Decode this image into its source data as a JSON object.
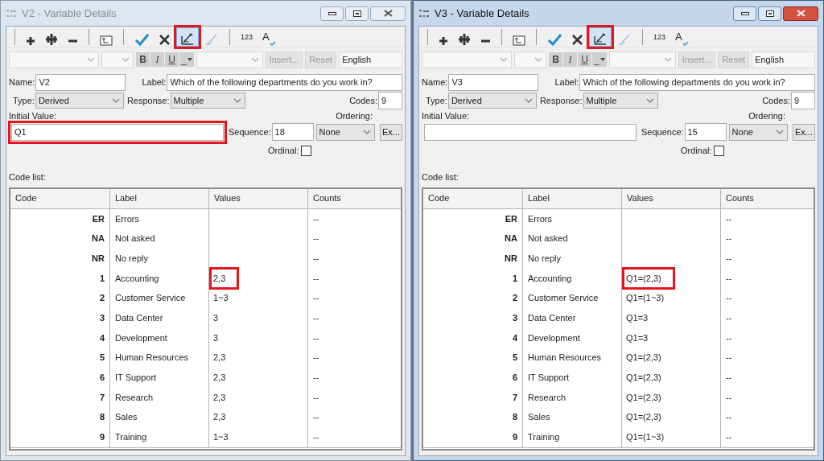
{
  "windows": [
    {
      "title": "V2 - Variable Details",
      "active": false,
      "toolbar": [
        [
          {
            "kind": "add",
            "highlighted": false,
            "disabled": false
          },
          {
            "kind": "add-multiple",
            "highlighted": false,
            "disabled": false
          },
          {
            "kind": "remove",
            "highlighted": false,
            "disabled": false
          }
        ],
        [
          {
            "kind": "import",
            "highlighted": false,
            "disabled": false
          }
        ],
        [
          {
            "kind": "accept",
            "highlighted": false,
            "disabled": false
          },
          {
            "kind": "cancel",
            "highlighted": false,
            "disabled": false
          },
          {
            "kind": "ruler",
            "highlighted": true,
            "disabled": false
          },
          {
            "kind": "brush",
            "highlighted": false,
            "disabled": true
          }
        ],
        [
          {
            "kind": "numbering",
            "label": "123",
            "highlighted": false,
            "disabled": false
          },
          {
            "kind": "spellcheck",
            "label": "A",
            "highlighted": false,
            "disabled": false
          }
        ]
      ],
      "format_buttons": [
        {
          "kind": "bold",
          "label": "B"
        },
        {
          "kind": "italic",
          "label": "I"
        },
        {
          "kind": "underline",
          "label": "U"
        },
        {
          "kind": "line",
          "label": "_"
        }
      ],
      "insert_button": {
        "label": "Insert...",
        "disabled": true
      },
      "reset_button": {
        "label": "Reset",
        "disabled": true
      },
      "language": "English",
      "name": {
        "label": "Name:",
        "value": "V2"
      },
      "var_label": {
        "label": "Label:",
        "value": "Which of the following departments do you work in?"
      },
      "type": {
        "label": "Type:",
        "value": "Derived"
      },
      "response": {
        "label": "Response:",
        "value": "Multiple"
      },
      "codes": {
        "label": "Codes:",
        "value": "9"
      },
      "initial_value": {
        "label": "Initial Value:",
        "value": "Q1",
        "highlighted": true
      },
      "sequence": {
        "label": "Sequence:",
        "value": "18"
      },
      "ordering": {
        "label": "Ordering:",
        "value": "None"
      },
      "ex_button": "Ex...",
      "ordinal": {
        "label": "Ordinal:",
        "checked": false
      },
      "code_list": {
        "label": "Code list:",
        "columns": [
          "Code",
          "Label",
          "Values",
          "Counts"
        ],
        "rows": [
          {
            "code": "ER",
            "label": "Errors",
            "counts": "--",
            "highlighted": false
          },
          {
            "code": "NA",
            "label": "Not asked",
            "counts": "--",
            "highlighted": false
          },
          {
            "code": "NR",
            "label": "No reply",
            "counts": "--",
            "highlighted": false
          },
          {
            "code": "1",
            "label": "Accounting",
            "values": "2,3",
            "counts": "--",
            "highlighted": true
          },
          {
            "code": "2",
            "label": "Customer Service",
            "values": "1~3",
            "counts": "--",
            "highlighted": false
          },
          {
            "code": "3",
            "label": "Data Center",
            "values": "3",
            "counts": "--",
            "highlighted": false
          },
          {
            "code": "4",
            "label": "Development",
            "values": "3",
            "counts": "--",
            "highlighted": false
          },
          {
            "code": "5",
            "label": "Human Resources",
            "values": "2,3",
            "counts": "--",
            "highlighted": false
          },
          {
            "code": "6",
            "label": "IT Support",
            "values": "2,3",
            "counts": "--",
            "highlighted": false
          },
          {
            "code": "7",
            "label": "Research",
            "values": "2,3",
            "counts": "--",
            "highlighted": false
          },
          {
            "code": "8",
            "label": "Sales",
            "values": "2,3",
            "counts": "--",
            "highlighted": false
          },
          {
            "code": "9",
            "label": "Training",
            "values": "1~3",
            "counts": "--",
            "highlighted": false
          }
        ]
      }
    },
    {
      "title": "V3 - Variable Details",
      "active": true,
      "toolbar": [
        [
          {
            "kind": "add",
            "highlighted": false,
            "disabled": false
          },
          {
            "kind": "add-multiple",
            "highlighted": false,
            "disabled": false
          },
          {
            "kind": "remove",
            "highlighted": false,
            "disabled": false
          }
        ],
        [
          {
            "kind": "import",
            "highlighted": false,
            "disabled": false
          }
        ],
        [
          {
            "kind": "accept",
            "highlighted": false,
            "disabled": false
          },
          {
            "kind": "cancel",
            "highlighted": false,
            "disabled": false
          },
          {
            "kind": "ruler",
            "highlighted": true,
            "disabled": false
          },
          {
            "kind": "brush",
            "highlighted": false,
            "disabled": true
          }
        ],
        [
          {
            "kind": "numbering",
            "label": "123",
            "highlighted": false,
            "disabled": false
          },
          {
            "kind": "spellcheck",
            "label": "A",
            "highlighted": false,
            "disabled": false
          }
        ]
      ],
      "format_buttons": [
        {
          "kind": "bold",
          "label": "B"
        },
        {
          "kind": "italic",
          "label": "I"
        },
        {
          "kind": "underline",
          "label": "U"
        },
        {
          "kind": "line",
          "label": "_"
        }
      ],
      "insert_button": {
        "label": "Insert...",
        "disabled": true
      },
      "reset_button": {
        "label": "Reset",
        "disabled": true
      },
      "language": "English",
      "name": {
        "label": "Name:",
        "value": "V3"
      },
      "var_label": {
        "label": "Label:",
        "value": "Which of the following departments do you work in?"
      },
      "type": {
        "label": "Type:",
        "value": "Derived"
      },
      "response": {
        "label": "Response:",
        "value": "Multiple"
      },
      "codes": {
        "label": "Codes:",
        "value": "9"
      },
      "initial_value": {
        "label": "Initial Value:",
        "highlighted": false
      },
      "sequence": {
        "label": "Sequence:",
        "value": "15"
      },
      "ordering": {
        "label": "Ordering:",
        "value": "None"
      },
      "ex_button": "Ex...",
      "ordinal": {
        "label": "Ordinal:",
        "checked": false
      },
      "code_list": {
        "label": "Code list:",
        "columns": [
          "Code",
          "Label",
          "Values",
          "Counts"
        ],
        "rows": [
          {
            "code": "ER",
            "label": "Errors",
            "counts": "--",
            "highlighted": false
          },
          {
            "code": "NA",
            "label": "Not asked",
            "counts": "--",
            "highlighted": false
          },
          {
            "code": "NR",
            "label": "No reply",
            "counts": "--",
            "highlighted": false
          },
          {
            "code": "1",
            "label": "Accounting",
            "values": "Q1=(2,3)",
            "counts": "--",
            "highlighted": true
          },
          {
            "code": "2",
            "label": "Customer Service",
            "values": "Q1=(1~3)",
            "counts": "--",
            "highlighted": false
          },
          {
            "code": "3",
            "label": "Data Center",
            "values": "Q1=3",
            "counts": "--",
            "highlighted": false
          },
          {
            "code": "4",
            "label": "Development",
            "values": "Q1=3",
            "counts": "--",
            "highlighted": false
          },
          {
            "code": "5",
            "label": "Human Resources",
            "values": "Q1=(2,3)",
            "counts": "--",
            "highlighted": false
          },
          {
            "code": "6",
            "label": "IT Support",
            "values": "Q1=(2,3)",
            "counts": "--",
            "highlighted": false
          },
          {
            "code": "7",
            "label": "Research",
            "values": "Q1=(2,3)",
            "counts": "--",
            "highlighted": false
          },
          {
            "code": "8",
            "label": "Sales",
            "values": "Q1=(2,3)",
            "counts": "--",
            "highlighted": false
          },
          {
            "code": "9",
            "label": "Training",
            "values": "Q1=(1~3)",
            "counts": "--",
            "highlighted": false
          }
        ]
      }
    }
  ]
}
